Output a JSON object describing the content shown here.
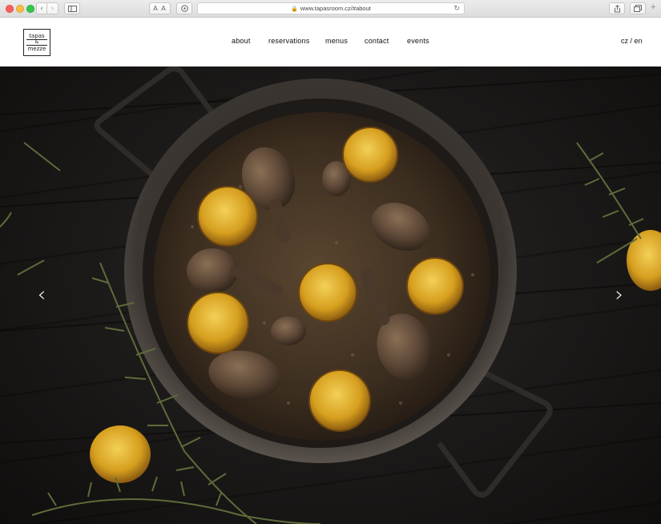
{
  "browser": {
    "url": "www.tapasroom.cz/#about",
    "text_size_label": "A A"
  },
  "logo": {
    "line1": "tapas",
    "line2": "&",
    "line3": "mezze"
  },
  "nav": {
    "items": [
      {
        "label": "about"
      },
      {
        "label": "reservations"
      },
      {
        "label": "menus"
      },
      {
        "label": "contact"
      },
      {
        "label": "events"
      }
    ]
  },
  "language": {
    "label": "cz / en"
  },
  "hero": {
    "prev_icon": "chevron-left-icon",
    "next_icon": "chevron-right-icon",
    "prev_glyph": "‹",
    "next_glyph": "›"
  },
  "colors": {
    "wood_dark": "#1b1918",
    "pan": "#3a3531",
    "rice": "#4a3a28",
    "lemon": "#e0b02a",
    "rosemary": "#5f6b3a"
  }
}
